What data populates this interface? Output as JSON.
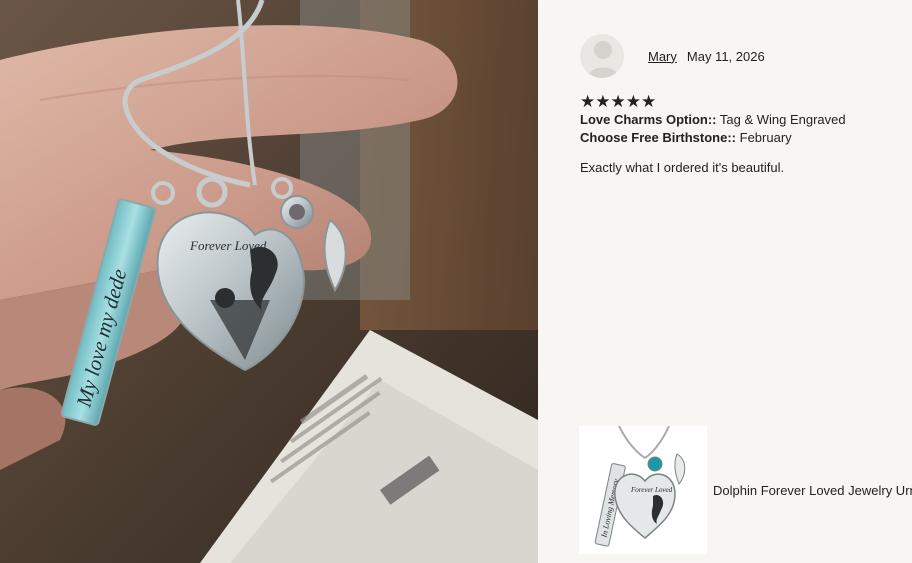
{
  "review": {
    "reviewer_name": "Mary",
    "date": "May 11, 2026",
    "rating": 5,
    "stars": "★★★★★",
    "options": [
      {
        "label": "Love Charms Option::",
        "value": " Tag & Wing Engraved"
      },
      {
        "label": "Choose Free Birthstone::",
        "value": " February"
      }
    ],
    "text": "Exactly what I ordered it's beautiful."
  },
  "photo": {
    "engraving_tag": "My love my dede",
    "engraving_heart": "Forever Loved"
  },
  "product": {
    "name": "Dolphin Forever Loved Jewelry Urn -",
    "thumb_engraving_tag": "In Loving Memory",
    "thumb_engraving_heart": "Forever Loved",
    "birthstone_color": "#1b9aa6"
  }
}
